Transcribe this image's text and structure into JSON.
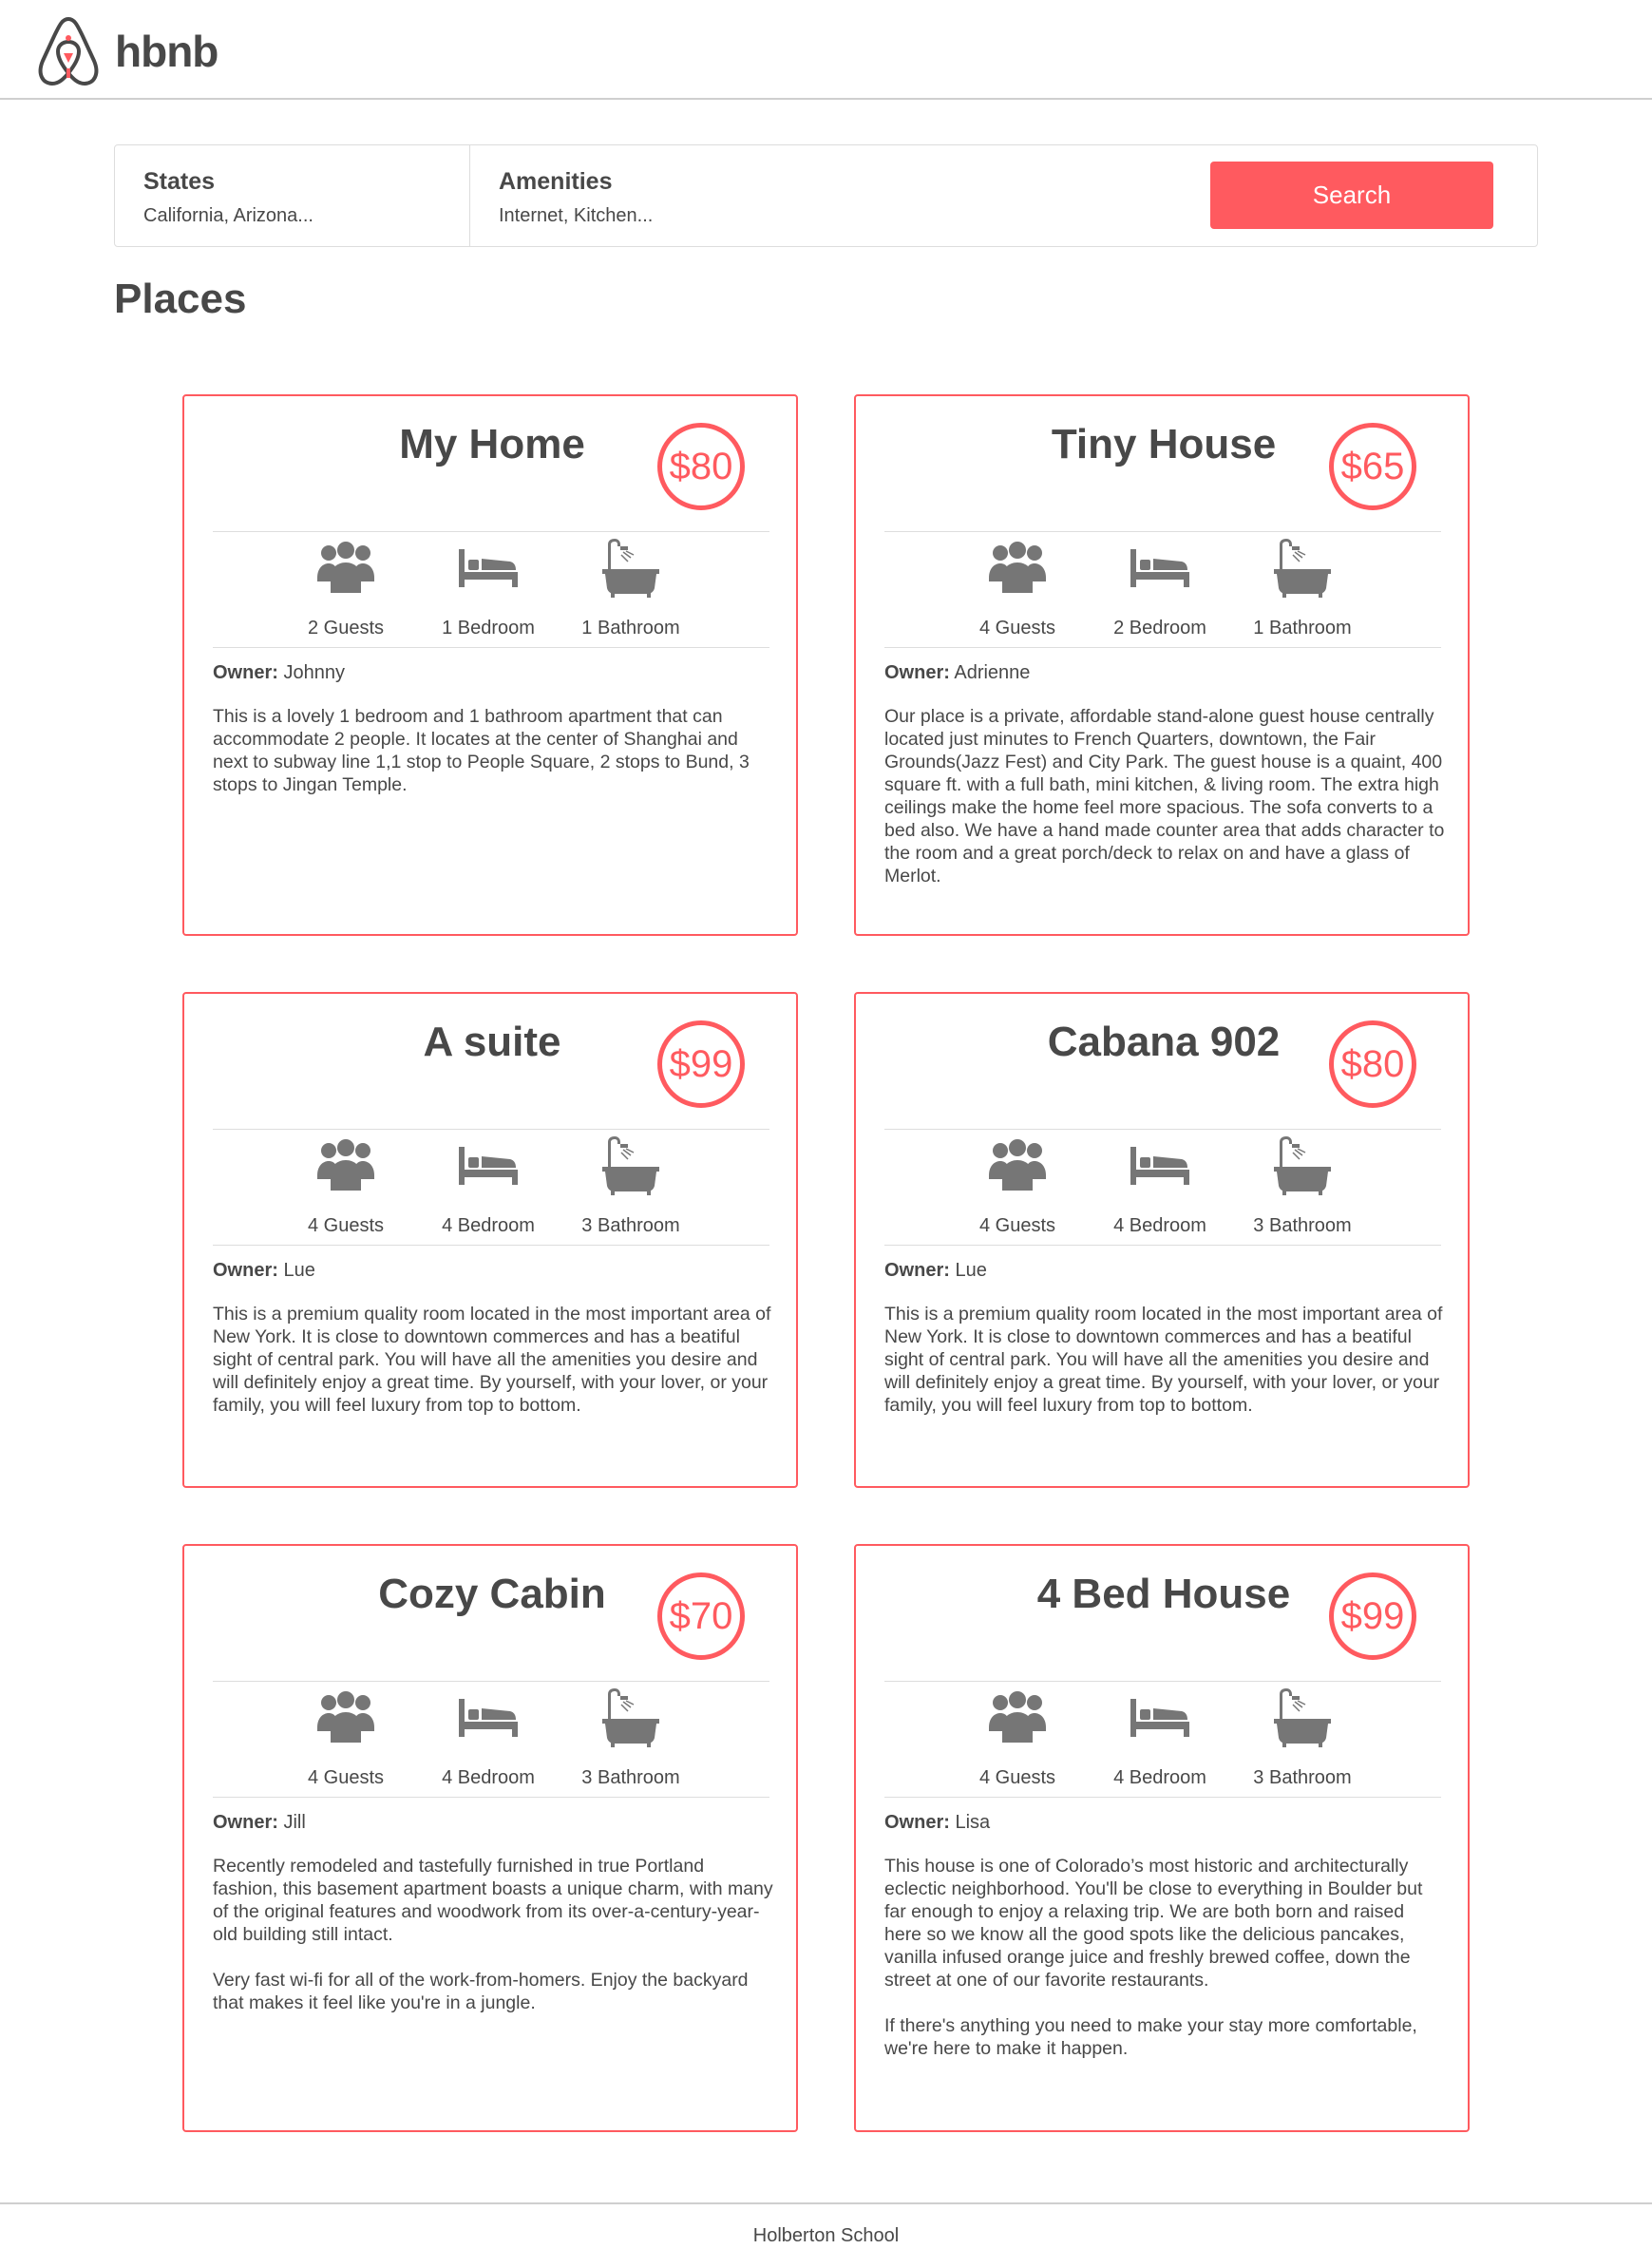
{
  "brand": {
    "name": "hbnb",
    "accent": "#ff5a5f"
  },
  "filters": {
    "states": {
      "title": "States",
      "value": "California, Arizona..."
    },
    "amenities": {
      "title": "Amenities",
      "value": "Internet, Kitchen..."
    },
    "search_label": "Search"
  },
  "section_title": "Places",
  "places": [
    {
      "name": "My Home",
      "price": "$80",
      "guests": "2 Guests",
      "bedrooms": "1 Bedroom",
      "bathrooms": "1 Bathroom",
      "owner_label": "Owner:",
      "owner": "Johnny",
      "description": [
        "This is a lovely 1 bedroom and 1 bathroom apartment that can accommodate 2 people. It locates at the center of Shanghai and next to subway line 1,1 stop to People Square, 2 stops to Bund, 3 stops to Jingan Temple."
      ]
    },
    {
      "name": "Tiny House",
      "price": "$65",
      "guests": "4 Guests",
      "bedrooms": "2 Bedroom",
      "bathrooms": "1 Bathroom",
      "owner_label": "Owner:",
      "owner": "Adrienne",
      "description": [
        "Our place is a private, affordable stand-alone guest house centrally located just minutes to French Quarters, downtown, the Fair Grounds(Jazz Fest) and City Park. The guest house is a quaint, 400 square ft. with a full bath, mini kitchen, & living room. The extra high ceilings make the home feel more spacious. The sofa converts to a bed also. We have a hand made counter area that adds character to the room and a great porch/deck to relax on and have a glass of Merlot."
      ]
    },
    {
      "name": "A suite",
      "price": "$99",
      "guests": "4 Guests",
      "bedrooms": "4 Bedroom",
      "bathrooms": "3 Bathroom",
      "owner_label": "Owner:",
      "owner": "Lue",
      "description": [
        "This is a premium quality room located in the most important area of New York. It is close to downtown commerces and has a beatiful sight of central park. You will have all the amenities you desire and will definitely enjoy a great time. By yourself, with your lover, or your family, you will feel luxury from top to bottom."
      ]
    },
    {
      "name": "Cabana 902",
      "price": "$80",
      "guests": "4 Guests",
      "bedrooms": "4 Bedroom",
      "bathrooms": "3 Bathroom",
      "owner_label": "Owner:",
      "owner": "Lue",
      "description": [
        "This is a premium quality room located in the most important area of New York. It is close to downtown commerces and has a beatiful sight of central park. You will have all the amenities you desire and will definitely enjoy a great time. By yourself, with your lover, or your family, you will feel luxury from top to bottom."
      ]
    },
    {
      "name": "Cozy Cabin",
      "price": "$70",
      "guests": "4 Guests",
      "bedrooms": "4 Bedroom",
      "bathrooms": "3 Bathroom",
      "owner_label": "Owner:",
      "owner": "Jill",
      "description": [
        "Recently remodeled and tastefully furnished in true Portland fashion, this basement apartment boasts a unique charm, with many of the original features and woodwork from its over-a-century-year-old building still intact.",
        "Very fast wi-fi for all of the work-from-homers. Enjoy the backyard that makes it feel like you're in a jungle."
      ]
    },
    {
      "name": "4 Bed House",
      "price": "$99",
      "guests": "4 Guests",
      "bedrooms": "4 Bedroom",
      "bathrooms": "3 Bathroom",
      "owner_label": "Owner:",
      "owner": "Lisa",
      "description": [
        "This house is one of Colorado’s most historic and architecturally eclectic neighborhood. You'll be close to everything in Boulder but far enough to enjoy a relaxing trip. We are both born and raised here so we know all the good spots like the delicious pancakes, vanilla infused orange juice and freshly brewed coffee, down the street at one of our favorite restaurants.",
        "If there's anything you need to make your stay more comfortable, we're here to make it happen."
      ]
    }
  ],
  "icons": {
    "guests": "group-icon",
    "bedrooms": "bed-icon",
    "bathrooms": "bathtub-icon"
  },
  "footer": "Holberton School"
}
